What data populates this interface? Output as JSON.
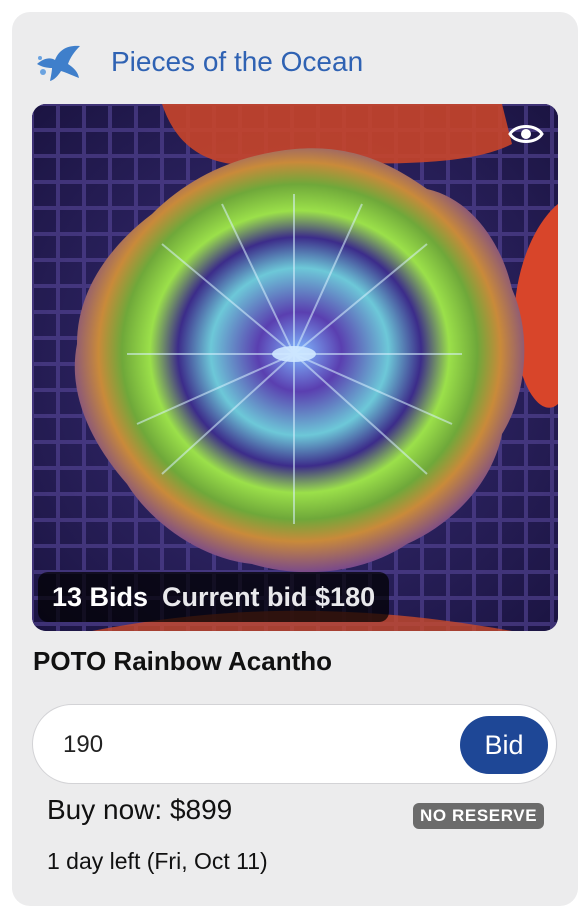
{
  "seller": {
    "name": "Pieces of the Ocean",
    "logo_icon": "manta-ray-icon"
  },
  "listing": {
    "title": "POTO Rainbow Acantho",
    "bids_label": "13 Bids",
    "current_bid_label": "Current bid $180",
    "watch_icon": "eye-icon",
    "image_subject": "coral-photo"
  },
  "bid_form": {
    "amount_value": "190",
    "button_label": "Bid"
  },
  "buy_now_label": "Buy now: $899",
  "reserve_badge": "NO RESERVE",
  "time_left": "1 day left (Fri, Oct 11)",
  "colors": {
    "card_background": "#ececed",
    "seller_link": "#2f62b3",
    "bid_button": "#1e4796",
    "badge": "#6b6b6b"
  }
}
